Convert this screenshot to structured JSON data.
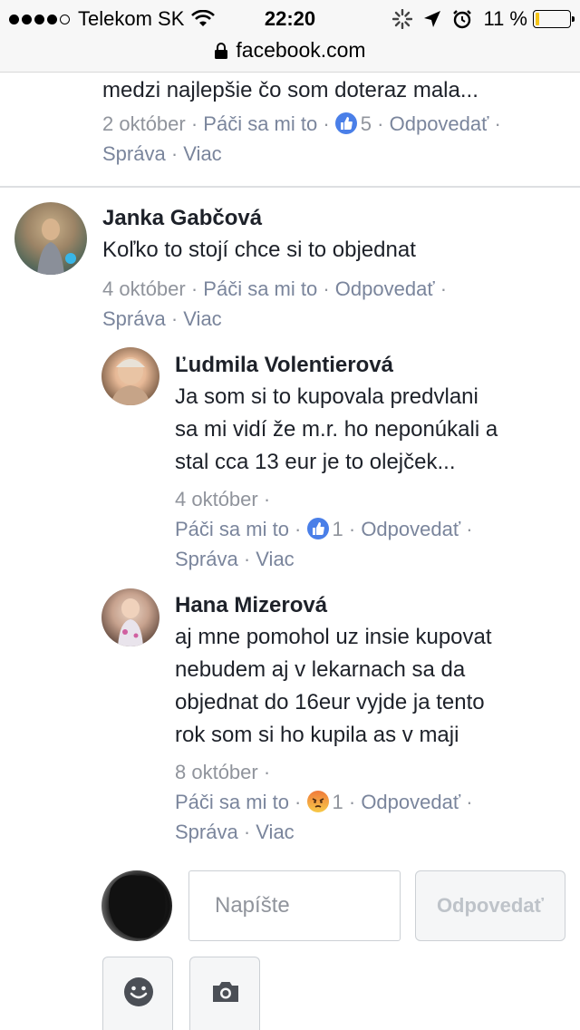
{
  "status_bar": {
    "carrier": "Telekom SK",
    "time": "22:20",
    "battery": "11 %",
    "battery_level": 0.11
  },
  "url_bar": {
    "domain": "facebook.com"
  },
  "top_comment": {
    "text": "medzi najlepšie čo som doteraz mala...",
    "date": "2 október",
    "like": "Páči sa mi to",
    "reaction_count": "5",
    "reply": "Odpovedať",
    "message": "Správa",
    "more": "Viac"
  },
  "comments": [
    {
      "author": "Janka Gabčová",
      "text": "Koľko to stojí chce si to objednat",
      "date": "4 október",
      "like": "Páči sa mi to",
      "reply": "Odpovedať",
      "message": "Správa",
      "more": "Viac"
    },
    {
      "author": "Ľudmila Volentierová",
      "text_lines": [
        "Ja som si to kupovala predvlani",
        "sa mi vidí že m.r. ho neponúkali a",
        "stal cca 13 eur je to olejček..."
      ],
      "date": "4 október",
      "like": "Páči sa mi to",
      "reaction_count": "1",
      "reaction_type": "like-icon",
      "reply": "Odpovedať",
      "message": "Správa",
      "more": "Viac"
    },
    {
      "author": "Hana Mizerová",
      "text_lines": [
        "aj mne pomohol uz insie kupovat",
        "nebudem aj v lekarnach sa da",
        "objednat do 16eur vyjde ja tento",
        "rok som si ho kupila as v maji"
      ],
      "date": "8 október",
      "like": "Páči sa mi to",
      "reaction_count": "1",
      "reaction_type": "angry-icon",
      "reply": "Odpovedať",
      "message": "Správa",
      "more": "Viac"
    }
  ],
  "composer": {
    "placeholder": "Napíšte",
    "submit_label": "Odpovedať",
    "emoji_icon": "smiley-icon",
    "camera_icon": "camera-icon"
  },
  "colors": {
    "link_gray": "#90949c",
    "like_blue": "#4a7fe8",
    "battery_yellow": "#f5c518"
  }
}
